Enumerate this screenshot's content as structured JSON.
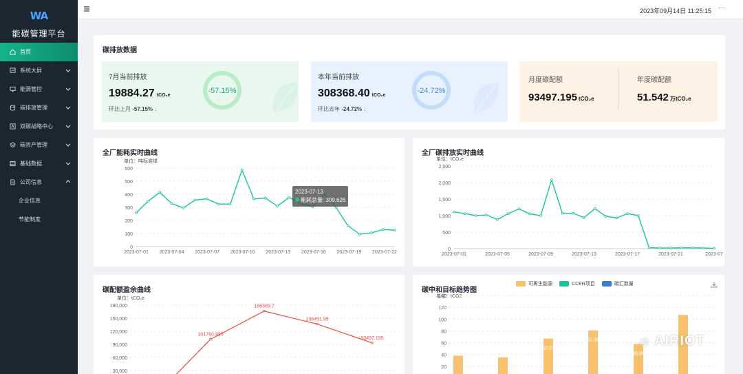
{
  "app": {
    "logo_text": "WA",
    "title": "能碳管理平台"
  },
  "sidebar": {
    "items": [
      {
        "label": "首页",
        "icon": "home-icon",
        "active": true
      },
      {
        "label": "系统大屏",
        "icon": "chart-screen-icon"
      },
      {
        "label": "能源管控",
        "icon": "monitor-icon"
      },
      {
        "label": "碳排放管理",
        "icon": "database-icon"
      },
      {
        "label": "双碳战略中心",
        "icon": "strategy-icon"
      },
      {
        "label": "碳资产管理",
        "icon": "layers-icon"
      },
      {
        "label": "基础数据",
        "icon": "table-icon"
      },
      {
        "label": "公司信息",
        "icon": "document-icon",
        "expanded": true
      }
    ],
    "sub_items": [
      {
        "label": "企业信息"
      },
      {
        "label": "节能制度"
      }
    ]
  },
  "header": {
    "datetime": "2023年09月14日 11:25:15",
    "more": "···"
  },
  "emission": {
    "title": "碳排放数据",
    "month": {
      "label": "7月当前排放",
      "value": "19884.27",
      "unit": "tCO₂e",
      "ring": "-57.15%",
      "sub_prefix": "环比上月",
      "sub_value": "-57.15%"
    },
    "year": {
      "label": "本年当前排放",
      "value": "308368.40",
      "unit": "tCO₂e",
      "ring": "-24.72%",
      "sub_prefix": "环比去年",
      "sub_value": "-24.72%"
    },
    "quota": {
      "monthly_label": "月度碳配额",
      "monthly_value": "93497.195",
      "monthly_unit": "tCO₂e",
      "yearly_label": "年度碳配额",
      "yearly_value": "51.542",
      "yearly_unit": "万tCO₂e"
    }
  },
  "colors": {
    "accent": "#19c49a",
    "sidebar_bg": "#1b2630",
    "line_red": "#f04a3e",
    "bar_orange": "#f7c16d",
    "blue": "#3a7bd5"
  },
  "charts": {
    "energy": {
      "title": "全厂能耗实时曲线",
      "unit": "单位：吨标准煤",
      "tooltip": {
        "date": "2023-07-13",
        "series": "能耗总量",
        "value": "309.626"
      }
    },
    "carbon": {
      "title": "全厂碳排放实时曲线",
      "unit": "单位：tCO₂e"
    },
    "quota": {
      "title": "碳配额盈余曲线",
      "unit": "单位：tCO₂e"
    },
    "trend": {
      "title": "碳中和目标趋势图",
      "unit": "单位：tCO2",
      "legend": [
        {
          "name": "可再生能源",
          "color": "#f7c16d"
        },
        {
          "name": "CCER项目",
          "color": "#19c49a"
        },
        {
          "name": "碳汇数量",
          "color": "#3a7bd5"
        }
      ]
    }
  },
  "watermark": "AIRIOT",
  "chart_data": [
    {
      "type": "line",
      "title": "全厂能耗实时曲线",
      "ylabel": "单位：吨标准煤",
      "ylim": [
        0,
        600
      ],
      "yticks": [
        0,
        100,
        200,
        300,
        400,
        500,
        600
      ],
      "x_ticks": [
        "2023-07-01",
        "2023-07-04",
        "2023-07-07",
        "2023-07-10",
        "2023-07-13",
        "2023-07-16",
        "2023-07-19",
        "2023-07-22"
      ],
      "x": [
        "2023-07-01",
        "2023-07-02",
        "2023-07-03",
        "2023-07-04",
        "2023-07-05",
        "2023-07-06",
        "2023-07-07",
        "2023-07-08",
        "2023-07-09",
        "2023-07-10",
        "2023-07-11",
        "2023-07-12",
        "2023-07-13",
        "2023-07-14",
        "2023-07-15",
        "2023-07-16",
        "2023-07-17",
        "2023-07-18",
        "2023-07-19",
        "2023-07-20",
        "2023-07-21",
        "2023-07-22",
        "2023-07-23"
      ],
      "series": [
        {
          "name": "能耗总量",
          "color": "#19c49a",
          "values": [
            258,
            345,
            415,
            330,
            295,
            355,
            365,
            325,
            325,
            585,
            365,
            370,
            309.626,
            375,
            330,
            305,
            400,
            300,
            160,
            95,
            105,
            130,
            125
          ]
        }
      ]
    },
    {
      "type": "line",
      "title": "全厂碳排放实时曲线",
      "ylabel": "单位：tCO₂e",
      "ylim": [
        0,
        2500
      ],
      "yticks": [
        "0",
        "500",
        "1,000",
        "1,500",
        "2,000",
        "2,500"
      ],
      "x_ticks": [
        "2023-07-01",
        "2023-07-05",
        "2023-07-09",
        "2023-07-13",
        "2023-07-17",
        "2023-07-21",
        "2023-07"
      ],
      "x": [
        "2023-07-01",
        "2023-07-02",
        "2023-07-03",
        "2023-07-04",
        "2023-07-05",
        "2023-07-06",
        "2023-07-07",
        "2023-07-08",
        "2023-07-09",
        "2023-07-10",
        "2023-07-11",
        "2023-07-12",
        "2023-07-13",
        "2023-07-14",
        "2023-07-15",
        "2023-07-16",
        "2023-07-17",
        "2023-07-18",
        "2023-07-19",
        "2023-07-20",
        "2023-07-21",
        "2023-07-22",
        "2023-07-23",
        "2023-07-24",
        "2023-07-25"
      ],
      "series": [
        {
          "name": "",
          "color": "#19c49a",
          "values": [
            1110,
            1060,
            1000,
            1020,
            880,
            1060,
            1200,
            1050,
            1000,
            2080,
            1070,
            1070,
            940,
            1210,
            980,
            930,
            1060,
            1000,
            30,
            20,
            20,
            25,
            25,
            20,
            10
          ]
        }
      ]
    },
    {
      "type": "line",
      "title": "碳配额盈余曲线",
      "ylabel": "单位：tCO₂e",
      "ylim": [
        30000,
        180000
      ],
      "yticks": [
        "30,000",
        "60,000",
        "90,000",
        "120,000",
        "150,000",
        "180,000"
      ],
      "series": [
        {
          "name": "",
          "color": "#f04a3e",
          "points": [
            {
              "x": 0,
              "y": 5000,
              "label": ""
            },
            {
              "x": 1,
              "y": 101760.395,
              "label": "101760.395"
            },
            {
              "x": 2,
              "y": 166369.7,
              "label": "166369.7"
            },
            {
              "x": 3,
              "y": 136451.95,
              "label": "136451.95"
            },
            {
              "x": 4,
              "y": 93497.195,
              "label": "93497.195"
            }
          ]
        }
      ]
    },
    {
      "type": "bar",
      "title": "碳中和目标趋势图",
      "ylabel": "单位：tCO2",
      "ylim": [
        0,
        140
      ],
      "yticks": [
        0,
        20,
        40,
        60,
        80,
        100,
        120,
        140
      ],
      "series": [
        {
          "name": "可再生能源",
          "color": "#f7c16d",
          "values": [
            38,
            35,
            67,
            81,
            58,
            107
          ]
        },
        {
          "name": "CCER项目",
          "color": "#19c49a",
          "values": []
        },
        {
          "name": "碳汇数量",
          "color": "#3a7bd5",
          "values": []
        }
      ],
      "visible_bar_labels": [
        "",
        "",
        "32.29",
        "31.36",
        "30.96",
        ""
      ]
    }
  ]
}
